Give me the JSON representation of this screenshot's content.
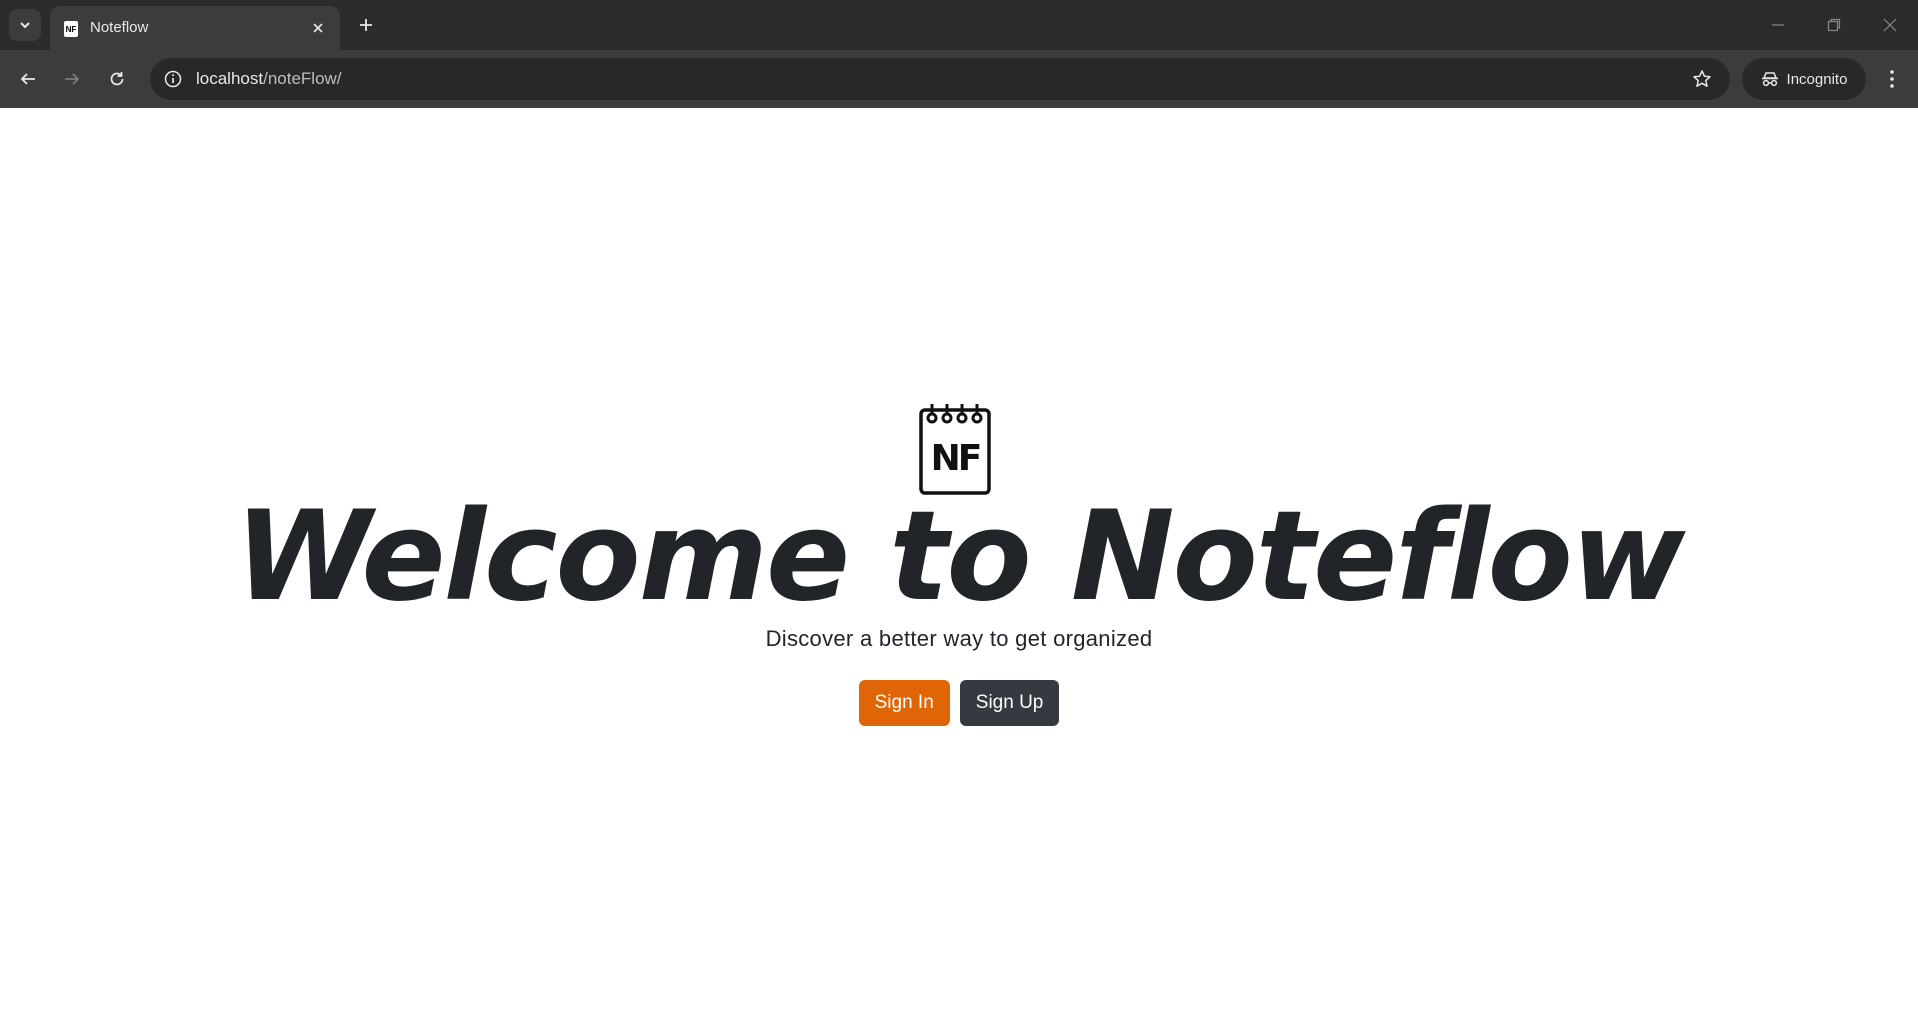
{
  "browser": {
    "tab_title": "Noteflow",
    "favicon_text": "NF",
    "url_host": "localhost",
    "url_path": "/noteFlow/",
    "incognito_label": "Incognito",
    "icons": [
      "tab-search-icon",
      "close-icon",
      "plus-icon",
      "minimize-icon",
      "restore-icon",
      "window-close-icon",
      "back-arrow-icon",
      "forward-arrow-icon",
      "reload-icon",
      "info-icon",
      "star-icon",
      "incognito-icon",
      "kebab-menu-icon"
    ]
  },
  "page": {
    "logo_text": "NF",
    "title": "Welcome to Noteflow",
    "subtitle": "Discover a better way to get organized",
    "signin_label": "Sign In",
    "signup_label": "Sign Up",
    "colors": {
      "signin_bg": "#df6507",
      "signup_bg": "#343a40",
      "text": "#212529"
    }
  }
}
